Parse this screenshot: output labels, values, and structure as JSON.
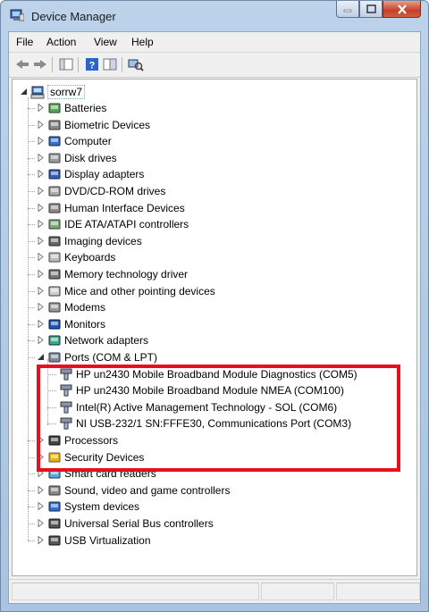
{
  "window": {
    "title": "Device Manager",
    "controls": {
      "minimize": "–",
      "maximize": "□",
      "close": "✕"
    }
  },
  "menu": [
    "File",
    "Action",
    "View",
    "Help"
  ],
  "toolbar": {
    "buttons": [
      "back-arrow-icon",
      "forward-arrow-icon",
      "show-hide-console-tree-icon",
      "help-icon",
      "properties-icon",
      "scan-hardware-icon"
    ]
  },
  "tree": {
    "root": "sorrw7",
    "categories": [
      {
        "label": "Batteries",
        "icon": "battery-icon",
        "expanded": false
      },
      {
        "label": "Biometric Devices",
        "icon": "biometric-icon",
        "expanded": false
      },
      {
        "label": "Computer",
        "icon": "computer-icon",
        "expanded": false
      },
      {
        "label": "Disk drives",
        "icon": "disk-drive-icon",
        "expanded": false
      },
      {
        "label": "Display adapters",
        "icon": "display-adapter-icon",
        "expanded": false
      },
      {
        "label": "DVD/CD-ROM drives",
        "icon": "dvd-drive-icon",
        "expanded": false
      },
      {
        "label": "Human Interface Devices",
        "icon": "hid-icon",
        "expanded": false
      },
      {
        "label": "IDE ATA/ATAPI controllers",
        "icon": "ide-controller-icon",
        "expanded": false
      },
      {
        "label": "Imaging devices",
        "icon": "imaging-device-icon",
        "expanded": false
      },
      {
        "label": "Keyboards",
        "icon": "keyboard-icon",
        "expanded": false
      },
      {
        "label": "Memory technology driver",
        "icon": "memory-icon",
        "expanded": false
      },
      {
        "label": "Mice and other pointing devices",
        "icon": "mouse-icon",
        "expanded": false
      },
      {
        "label": "Modems",
        "icon": "modem-icon",
        "expanded": false
      },
      {
        "label": "Monitors",
        "icon": "monitor-icon",
        "expanded": false
      },
      {
        "label": "Network adapters",
        "icon": "network-adapter-icon",
        "expanded": false
      },
      {
        "label": "Ports (COM & LPT)",
        "icon": "port-icon",
        "expanded": true,
        "children": [
          "HP un2430 Mobile Broadband Module Diagnostics (COM5)",
          "HP un2430 Mobile Broadband Module NMEA (COM100)",
          "Intel(R) Active Management Technology - SOL (COM6)",
          "NI USB-232/1 SN:FFFE30, Communications Port (COM3)"
        ]
      },
      {
        "label": "Processors",
        "icon": "processor-icon",
        "expanded": false
      },
      {
        "label": "Security Devices",
        "icon": "security-device-icon",
        "expanded": false
      },
      {
        "label": "Smart card readers",
        "icon": "smart-card-reader-icon",
        "expanded": false
      },
      {
        "label": "Sound, video and game controllers",
        "icon": "sound-icon",
        "expanded": false
      },
      {
        "label": "System devices",
        "icon": "system-device-icon",
        "expanded": false
      },
      {
        "label": "Universal Serial Bus controllers",
        "icon": "usb-icon",
        "expanded": false
      },
      {
        "label": "USB Virtualization",
        "icon": "usb-icon",
        "expanded": false
      }
    ]
  },
  "colors": {
    "highlight": "#e8101c",
    "titlebar": "#bcd3ea"
  }
}
